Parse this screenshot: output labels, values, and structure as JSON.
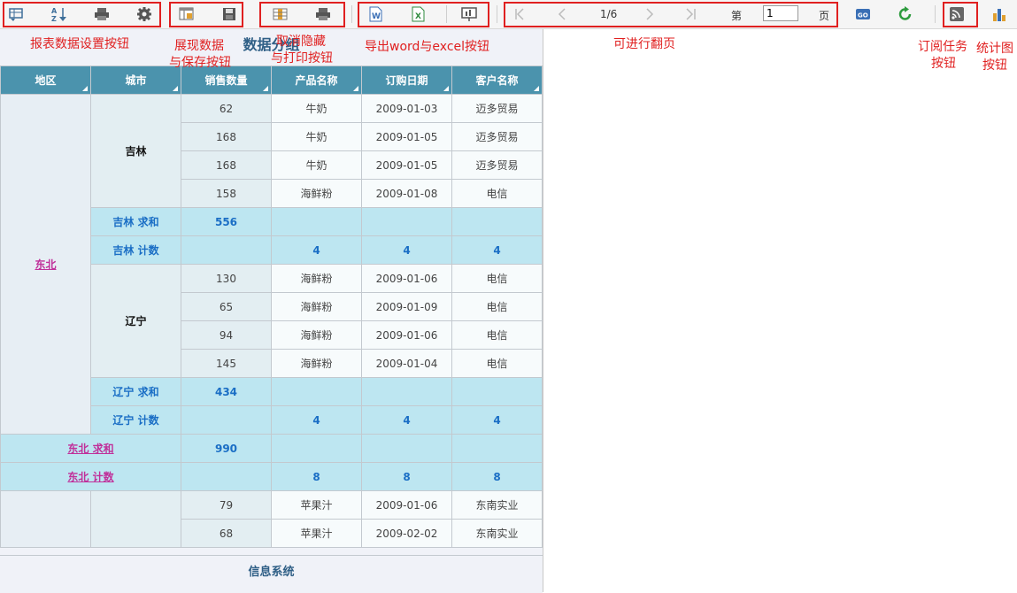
{
  "toolbar": {
    "pager": {
      "current": "1/6",
      "page_label_before": "第",
      "page_input": "1",
      "page_label_after": "页"
    }
  },
  "annotations": {
    "report_settings": "报表数据设置按钮",
    "display_save_1": "展现数据",
    "display_save_2": "与保存按钮",
    "cancel_hide_1": "取消隐藏",
    "cancel_hide_2": "与打印按钮",
    "export": "导出word与excel按钮",
    "paging": "可进行翻页",
    "subscribe_1": "订阅任务",
    "subscribe_2": "按钮",
    "chart_1": "统计图",
    "chart_2": "按钮"
  },
  "report": {
    "title": "数据分组",
    "columns": [
      "地区",
      "城市",
      "销售数量",
      "产品名称",
      "订购日期",
      "客户名称"
    ],
    "region": "东北",
    "groups": [
      {
        "city": "吉林",
        "rows": [
          [
            "62",
            "牛奶",
            "2009-01-03",
            "迈多贸易"
          ],
          [
            "168",
            "牛奶",
            "2009-01-05",
            "迈多贸易"
          ],
          [
            "168",
            "牛奶",
            "2009-01-05",
            "迈多贸易"
          ],
          [
            "158",
            "海鲜粉",
            "2009-01-08",
            "电信"
          ]
        ],
        "sum_label": "吉林 求和",
        "sum": "556",
        "count_label": "吉林 计数",
        "count": [
          "4",
          "4",
          "4"
        ]
      },
      {
        "city": "辽宁",
        "rows": [
          [
            "130",
            "海鲜粉",
            "2009-01-06",
            "电信"
          ],
          [
            "65",
            "海鲜粉",
            "2009-01-09",
            "电信"
          ],
          [
            "94",
            "海鲜粉",
            "2009-01-06",
            "电信"
          ],
          [
            "145",
            "海鲜粉",
            "2009-01-04",
            "电信"
          ]
        ],
        "sum_label": "辽宁 求和",
        "sum": "434",
        "count_label": "辽宁 计数",
        "count": [
          "4",
          "4",
          "4"
        ]
      }
    ],
    "region_sum_label": "东北 求和",
    "region_sum": "990",
    "region_count_label": "东北 计数",
    "region_count": [
      "8",
      "8",
      "8"
    ],
    "next_rows": [
      [
        "79",
        "苹果汁",
        "2009-01-06",
        "东南实业"
      ],
      [
        "68",
        "苹果汁",
        "2009-02-02",
        "东南实业"
      ]
    ],
    "footer": "信息系统"
  },
  "colors": {
    "header": "#4b93ad",
    "subtotal": "#bde6f1",
    "annotation": "#e02020",
    "link": "#c0309a"
  }
}
